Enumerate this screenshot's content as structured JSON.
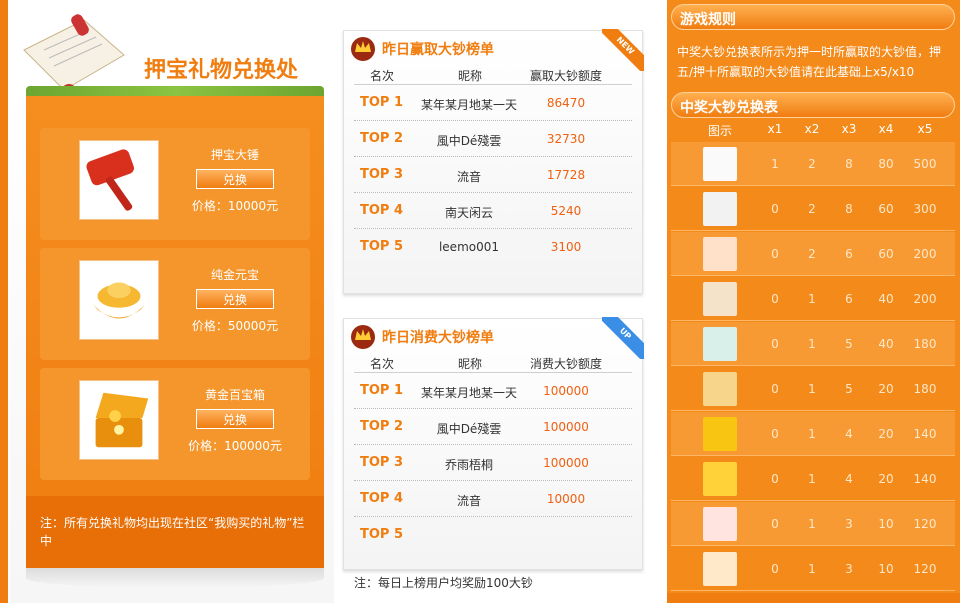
{
  "left": {
    "title": "押宝礼物兑换处",
    "gifts": [
      {
        "name": "押宝大锤",
        "button": "兑换",
        "price": "价格：10000元",
        "icon": "hammer-icon"
      },
      {
        "name": "纯金元宝",
        "button": "兑换",
        "price": "价格：50000元",
        "icon": "gold-ingot-icon"
      },
      {
        "name": "黄金百宝箱",
        "button": "兑换",
        "price": "价格：100000元",
        "icon": "treasure-chest-icon"
      }
    ],
    "note": "注：所有兑换礼物均出现在社区“我购买的礼物”栏中"
  },
  "rank_win": {
    "title": "昨日赢取大钞榜单",
    "ribbon": "NEW",
    "columns": [
      "名次",
      "昵称",
      "赢取大钞额度"
    ],
    "rows": [
      {
        "rank": "TOP 1",
        "name": "某年某月地某一天",
        "value": "86470"
      },
      {
        "rank": "TOP 2",
        "name": "風中Dé殘雲",
        "value": "32730"
      },
      {
        "rank": "TOP 3",
        "name": "流音",
        "value": "17728"
      },
      {
        "rank": "TOP 4",
        "name": "南天闲云",
        "value": "5240"
      },
      {
        "rank": "TOP 5",
        "name": "leemo001",
        "value": "3100"
      }
    ]
  },
  "rank_spend": {
    "title": "昨日消费大钞榜单",
    "ribbon": "UP",
    "columns": [
      "名次",
      "昵称",
      "消费大钞额度"
    ],
    "rows": [
      {
        "rank": "TOP 1",
        "name": "某年某月地某一天",
        "value": "100000"
      },
      {
        "rank": "TOP 2",
        "name": "風中Dé殘雲",
        "value": "100000"
      },
      {
        "rank": "TOP 3",
        "name": "乔雨梧桐",
        "value": "100000"
      },
      {
        "rank": "TOP 4",
        "name": "流音",
        "value": "10000"
      },
      {
        "rank": "TOP 5",
        "name": "",
        "value": ""
      }
    ],
    "note": "注：每日上榜用户均奖励100大钞"
  },
  "right": {
    "rules_title": "游戏规则",
    "rules_text": "中奖大钞兑换表所示为押一时所赢取的大钞值，押五/押十所赢取的大钞值请在此基础上x5/x10",
    "table_title": "中奖大钞兑换表",
    "columns": [
      "图示",
      "x1",
      "x2",
      "x3",
      "x4",
      "x5"
    ],
    "rows": [
      {
        "icon": "sheep-icon",
        "values": [
          "1",
          "2",
          "8",
          "80",
          "500"
        ]
      },
      {
        "icon": "card-icon",
        "values": [
          "0",
          "2",
          "8",
          "60",
          "300"
        ]
      },
      {
        "icon": "mascot-icon",
        "values": [
          "0",
          "2",
          "6",
          "60",
          "200"
        ]
      },
      {
        "icon": "dumpling-icon",
        "values": [
          "0",
          "1",
          "6",
          "40",
          "200"
        ]
      },
      {
        "icon": "bottle-icon",
        "values": [
          "0",
          "1",
          "5",
          "40",
          "180"
        ]
      },
      {
        "icon": "cookie-icon",
        "values": [
          "0",
          "1",
          "5",
          "20",
          "180"
        ]
      },
      {
        "icon": "lipton-icon",
        "values": [
          "0",
          "1",
          "4",
          "20",
          "140"
        ]
      },
      {
        "icon": "tea-box-icon",
        "values": [
          "0",
          "1",
          "4",
          "20",
          "140"
        ]
      },
      {
        "icon": "santa-icon",
        "values": [
          "0",
          "1",
          "3",
          "10",
          "120"
        ]
      },
      {
        "icon": "pumpkin-icon",
        "values": [
          "0",
          "1",
          "3",
          "10",
          "120"
        ]
      }
    ]
  },
  "colors": {
    "accent": "#f07d10",
    "panel": "#f38a1a",
    "text_orange": "#f06010"
  }
}
